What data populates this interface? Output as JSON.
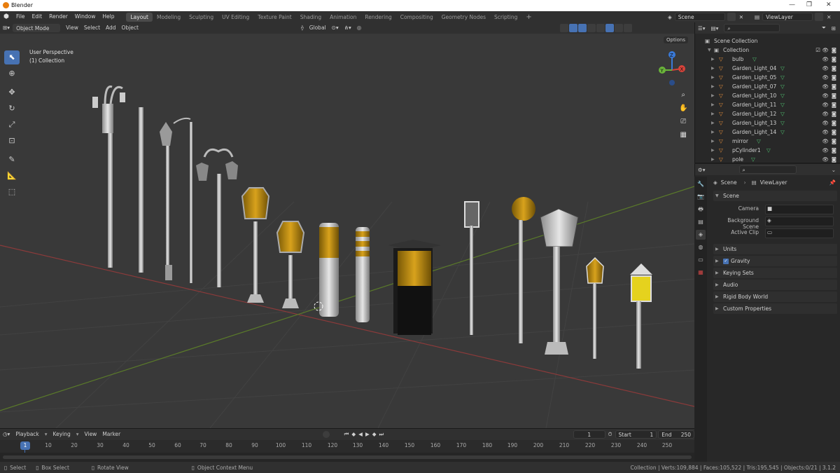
{
  "window": {
    "title": "Blender"
  },
  "menu": [
    "File",
    "Edit",
    "Render",
    "Window",
    "Help"
  ],
  "workspaces": [
    "Layout",
    "Modeling",
    "Sculpting",
    "UV Editing",
    "Texture Paint",
    "Shading",
    "Animation",
    "Rendering",
    "Compositing",
    "Geometry Nodes",
    "Scripting"
  ],
  "top_right": {
    "scene": "Scene",
    "view_layer": "ViewLayer"
  },
  "viewport_header": {
    "mode": "Object Mode",
    "items": [
      "View",
      "Select",
      "Add",
      "Object"
    ],
    "transform": "Global",
    "options": "Options"
  },
  "viewport": {
    "perspective": "User Perspective",
    "collection": "(1) Collection"
  },
  "gizmo": {
    "x": "X",
    "y": "Y",
    "z": "Z"
  },
  "outliner": {
    "root": "Scene Collection",
    "collection": "Collection",
    "items": [
      "bulb",
      "Garden_Light_04",
      "Garden_Light_05",
      "Garden_Light_07",
      "Garden_Light_10",
      "Garden_Light_11",
      "Garden_Light_12",
      "Garden_Light_13",
      "Garden_Light_14",
      "mirror",
      "pCylinder1",
      "pole"
    ]
  },
  "properties": {
    "breadcrumb_scene": "Scene",
    "breadcrumb_layer": "ViewLayer",
    "scene_panel": "Scene",
    "camera_label": "Camera",
    "bg_scene_label": "Background Scene",
    "active_clip_label": "Active Clip",
    "sections": [
      "Units",
      "Gravity",
      "Keying Sets",
      "Audio",
      "Rigid Body World",
      "Custom Properties"
    ]
  },
  "timeline": {
    "menus": [
      "Playback",
      "Keying",
      "View",
      "Marker"
    ],
    "current_frame": "1",
    "start_label": "Start",
    "start": "1",
    "end_label": "End",
    "end": "250",
    "ticks": [
      "1",
      "10",
      "20",
      "30",
      "40",
      "50",
      "60",
      "70",
      "80",
      "90",
      "100",
      "110",
      "120",
      "130",
      "140",
      "150",
      "160",
      "170",
      "180",
      "190",
      "200",
      "210",
      "220",
      "230",
      "240",
      "250"
    ]
  },
  "status": {
    "select": "Select",
    "box_select": "Box Select",
    "rotate_view": "Rotate View",
    "context_menu": "Object Context Menu",
    "stats": "Collection | Verts:109,884 | Faces:105,522 | Tris:195,545 | Objects:0/21 | 3.1.2"
  }
}
